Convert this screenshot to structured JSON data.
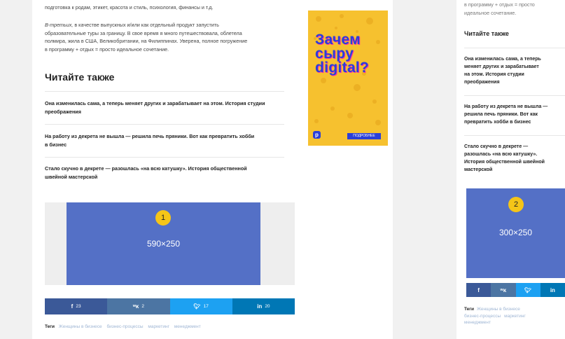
{
  "desktop": {
    "para1": "подготовка к родам, этикет, красота и стиль, психология, финансы и т.д.",
    "para2_lead": "В-третьих,",
    "para2_l1": " в качестве выпускных и/или как отдельный продукт запустить",
    "para2_l2": "образовательные туры за границу. В свое время я много путешествовала, облетела",
    "para2_l3": "полмира, жила в США, Великобритании, на Филиппинах. Уверена, полное погружение",
    "para2_l4": "в программу + отдых = просто идеальное сочетание.",
    "read_also": "Читайте также",
    "links": [
      [
        "Она изменилась сама, а теперь меняет других и зарабатывает на этом. История студии",
        "преображения"
      ],
      [
        "На работу из декрета не вышла — решила печь пряники. Вот как превратить хобби",
        "в бизнес"
      ],
      [
        "Стало скучно в декрете — разошлась «на всю катушку». История общественной",
        "швейной мастерской"
      ]
    ],
    "ad_label": "590×250",
    "ad_badge": "1",
    "share": [
      {
        "icon": "f",
        "count": "23",
        "color": "#3b5998"
      },
      {
        "icon": "vk",
        "count": "2",
        "color": "#4c75a3"
      },
      {
        "icon": "tw",
        "count": "17",
        "color": "#1da1f2"
      },
      {
        "icon": "in",
        "count": "20",
        "color": "#0077b5"
      }
    ],
    "tags_label": "Теги",
    "tags": [
      "Женщины в бизнесе",
      "бизнес-процессы",
      "маркетинг",
      "менеджмент"
    ],
    "banner": {
      "lines": [
        "Зачем",
        "сыру",
        "digital?"
      ],
      "button": "ПОДРОБНЕЕ",
      "logo": "p",
      "bg": "#f6c12f",
      "fg": "#2b3fd8"
    }
  },
  "mobile": {
    "para_l1": "в программу + отдых = просто",
    "para_l2": "идеальное сочетание.",
    "read_also": "Читайте также",
    "links": [
      [
        "Она изменилась сама, а теперь",
        "меняет других и зарабатывает",
        "на этом. История студии",
        "преображения"
      ],
      [
        "На работу из декрета не вышла —",
        "решила печь пряники. Вот как",
        "превратить хобби в бизнес"
      ],
      [
        "Стало скучно в декрете —",
        "разошлась «на всю катушку».",
        "История общественной швейной",
        "мастерской"
      ]
    ],
    "ad_label": "300×250",
    "ad_badge": "2",
    "share_icons": [
      "f",
      "vk",
      "tw",
      "in"
    ],
    "tags_label": "Теги",
    "tags_l1": "Женщины в бизнесе",
    "tags_l2a": "бизнес-процессы",
    "tags_l2b": "маркетинг",
    "tags_l3": "менеджмент"
  }
}
